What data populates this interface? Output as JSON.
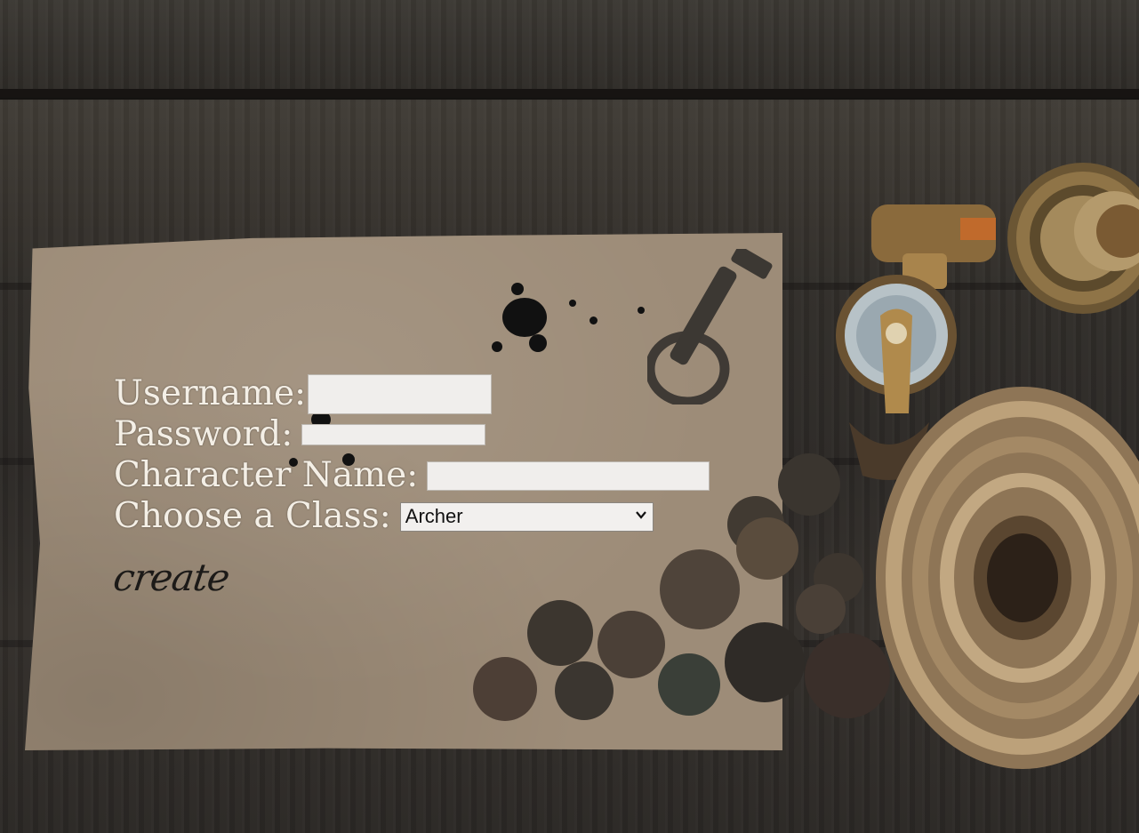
{
  "form": {
    "username_label": "Username:",
    "username_value": "",
    "password_label": "Password:",
    "password_value": "",
    "character_name_label": "Character Name:",
    "character_name_value": "",
    "class_label": "Choose a Class:",
    "class_selected": "Archer"
  },
  "actions": {
    "create_label": "create"
  },
  "colors": {
    "paper": "#9d8c78",
    "label_text": "#f4efe6",
    "create_text": "#1c1a18"
  },
  "icons": {
    "select_chevron": "chevron-down-icon"
  }
}
